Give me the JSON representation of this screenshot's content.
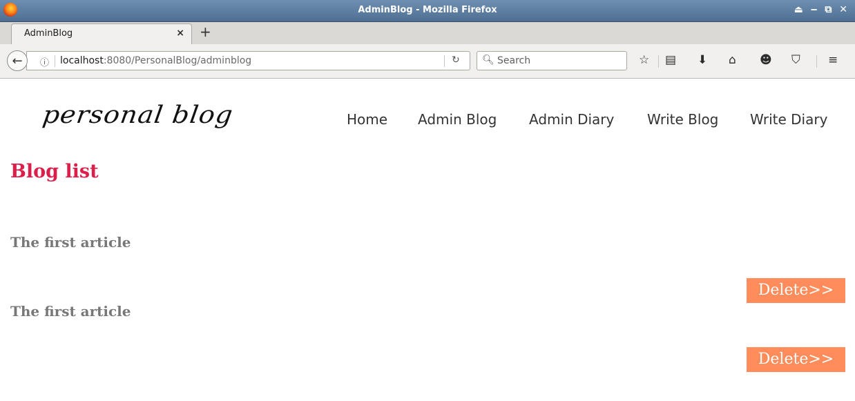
{
  "window": {
    "title": "AdminBlog - Mozilla Firefox",
    "controls": "⏏ ‒ ⧉ ✕"
  },
  "tab": {
    "label": "AdminBlog",
    "close": "×",
    "new": "+"
  },
  "urlbar": {
    "host": "localhost",
    "rest": ":8080/PersonalBlog/adminblog"
  },
  "search": {
    "placeholder": "Search"
  },
  "page": {
    "logo": "personal blog",
    "nav": [
      "Home",
      "Admin Blog",
      "Admin Diary",
      "Write Blog",
      "Write Diary"
    ],
    "heading": "Blog list",
    "articles": [
      {
        "title": "The first article",
        "action": "Delete>>"
      },
      {
        "title": "The first article",
        "action": "Delete>>"
      }
    ]
  },
  "colors": {
    "heading": "#dc1f4a",
    "button": "#ff8c5a",
    "article": "#777777"
  }
}
